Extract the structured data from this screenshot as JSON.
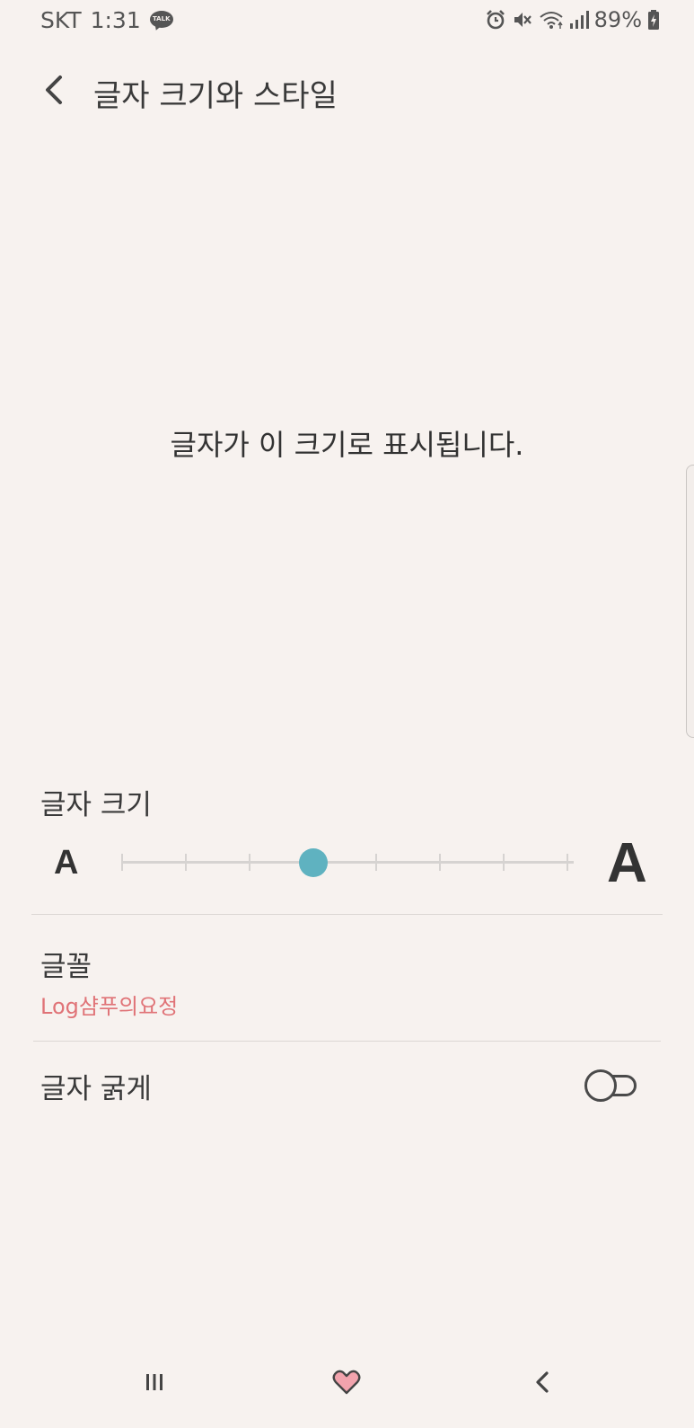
{
  "status_bar": {
    "carrier": "SKT",
    "time": "1:31",
    "talk_badge": "TALK",
    "battery": "89%",
    "icons": [
      "kakaotalk-icon",
      "alarm-icon",
      "mute-vibrate-icon",
      "wifi-icon",
      "signal-icon",
      "battery-charging-icon"
    ]
  },
  "app_bar": {
    "back_icon": "chevron-left-icon",
    "title": "글자 크기와 스타일"
  },
  "preview": {
    "text": "글자가 이 크기로 표시됩니다."
  },
  "font_size": {
    "label": "글자 크기",
    "small_glyph": "A",
    "large_glyph": "A",
    "levels": 8,
    "selected_level": 4,
    "accent_color": "#5fb2c0"
  },
  "font_style": {
    "label": "글꼴",
    "value": "Log샴푸의요정",
    "value_color": "#e07377"
  },
  "bold_text": {
    "label": "글자 굵게",
    "enabled": false
  },
  "nav_bar": {
    "icons": [
      "recents-icon",
      "home-heart-icon",
      "back-icon"
    ],
    "home_color": "#f2a3ad"
  }
}
